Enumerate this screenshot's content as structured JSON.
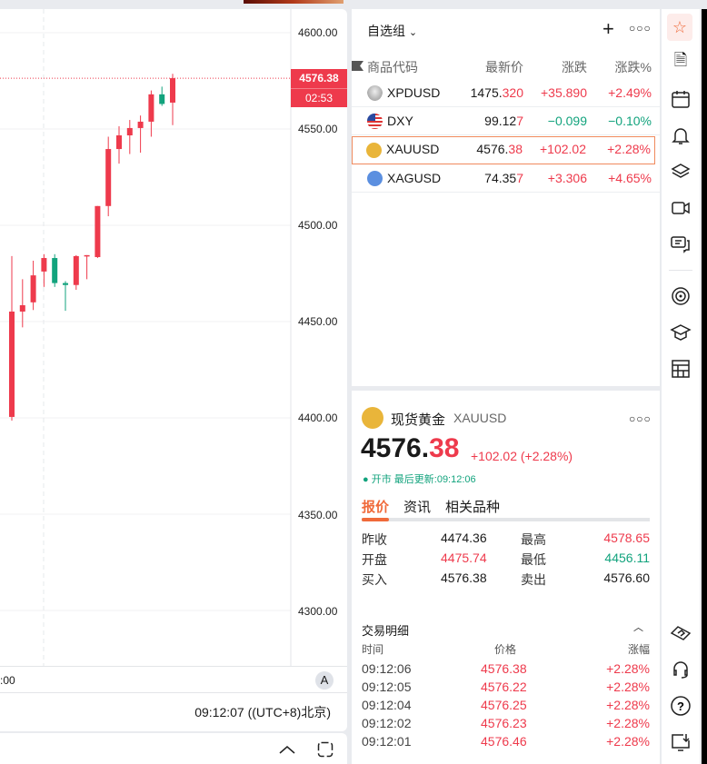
{
  "chart": {
    "y_ticks": [
      "4600.00",
      "4550.00",
      "4500.00",
      "4450.00",
      "4400.00",
      "4350.00",
      "4300.00"
    ],
    "last_price": "4576.38",
    "countdown": "02:53",
    "x_tick_partial": ":00",
    "auto_label": "A",
    "clock": "09:12:07 ((UTC+8)北京)",
    "colors": {
      "up": "#ee3a4c",
      "down": "#12a37d"
    }
  },
  "chart_data": {
    "type": "candlestick",
    "symbol": "XAUUSD",
    "ylim": [
      4290,
      4617
    ],
    "candles": [
      {
        "o": 4400.5,
        "h": 4484,
        "l": 4398.6,
        "c": 4455.2
      },
      {
        "o": 4455.2,
        "h": 4472,
        "l": 4447,
        "c": 4458.5
      },
      {
        "o": 4460,
        "h": 4481.6,
        "l": 4456,
        "c": 4474
      },
      {
        "o": 4476,
        "h": 4485,
        "l": 4468,
        "c": 4483
      },
      {
        "o": 4483,
        "h": 4485,
        "l": 4468,
        "c": 4470
      },
      {
        "o": 4470,
        "h": 4471,
        "l": 4455.6,
        "c": 4469
      },
      {
        "o": 4469,
        "h": 4484.5,
        "l": 4466.5,
        "c": 4484
      },
      {
        "o": 4484,
        "h": 4484.5,
        "l": 4472,
        "c": 4484.5
      },
      {
        "o": 4483.5,
        "h": 4510,
        "l": 4483,
        "c": 4510
      },
      {
        "o": 4510,
        "h": 4546,
        "l": 4504.7,
        "c": 4539.6
      },
      {
        "o": 4539.6,
        "h": 4551.4,
        "l": 4532,
        "c": 4546.7
      },
      {
        "o": 4546.7,
        "h": 4554.7,
        "l": 4537,
        "c": 4550.5
      },
      {
        "o": 4550.5,
        "h": 4557,
        "l": 4537.7,
        "c": 4553.8
      },
      {
        "o": 4553.8,
        "h": 4570,
        "l": 4546,
        "c": 4568
      },
      {
        "o": 4568,
        "h": 4572,
        "l": 4562,
        "c": 4563
      },
      {
        "o": 4563.7,
        "h": 4578.65,
        "l": 4552,
        "c": 4576.38
      }
    ]
  },
  "watchlist": {
    "group": "自选组",
    "headers": {
      "symbol": "商品代码",
      "last": "最新价",
      "change": "涨跌",
      "pct": "涨跌%"
    },
    "rows": [
      {
        "symbol": "XPDUSD",
        "last_a": "1475.",
        "last_b": "320",
        "change": "+35.890",
        "pct": "+2.49%",
        "dir": "up"
      },
      {
        "symbol": "DXY",
        "last_a": "99.12",
        "last_b": "7",
        "change": "−0.099",
        "pct": "−0.10%",
        "dir": "down"
      },
      {
        "symbol": "XAUUSD",
        "last_a": "4576.",
        "last_b": "38",
        "change": "+102.02",
        "pct": "+2.28%",
        "dir": "up"
      },
      {
        "symbol": "XAGUSD",
        "last_a": "74.35",
        "last_b": "7",
        "change": "+3.306",
        "pct": "+4.65%",
        "dir": "up"
      }
    ]
  },
  "detail": {
    "name": "现货黄金",
    "symbol": "XAUUSD",
    "price_a": "4576.",
    "price_b": "38",
    "change": "+102.02 (+2.28%)",
    "status": "开市",
    "updated": "最后更新:09:12:06",
    "tabs": [
      "报价",
      "资讯",
      "相关品种"
    ],
    "quote": [
      {
        "k1": "昨收",
        "v1": "4474.36",
        "k2": "最高",
        "v2": "4578.65"
      },
      {
        "k1": "开盘",
        "v1": "4475.74",
        "k2": "最低",
        "v2": "4456.11"
      },
      {
        "k1": "买入",
        "v1": "4576.38",
        "k2": "卖出",
        "v2": "4576.60"
      }
    ],
    "trades_title": "交易明细",
    "trade_headers": {
      "time": "时间",
      "price": "价格",
      "pct": "涨幅"
    },
    "trades": [
      {
        "time": "09:12:06",
        "price": "4576.38",
        "pct": "+2.28%"
      },
      {
        "time": "09:12:05",
        "price": "4576.22",
        "pct": "+2.28%"
      },
      {
        "time": "09:12:04",
        "price": "4576.25",
        "pct": "+2.28%"
      },
      {
        "time": "09:12:02",
        "price": "4576.23",
        "pct": "+2.28%"
      },
      {
        "time": "09:12:01",
        "price": "4576.46",
        "pct": "+2.28%"
      }
    ]
  }
}
